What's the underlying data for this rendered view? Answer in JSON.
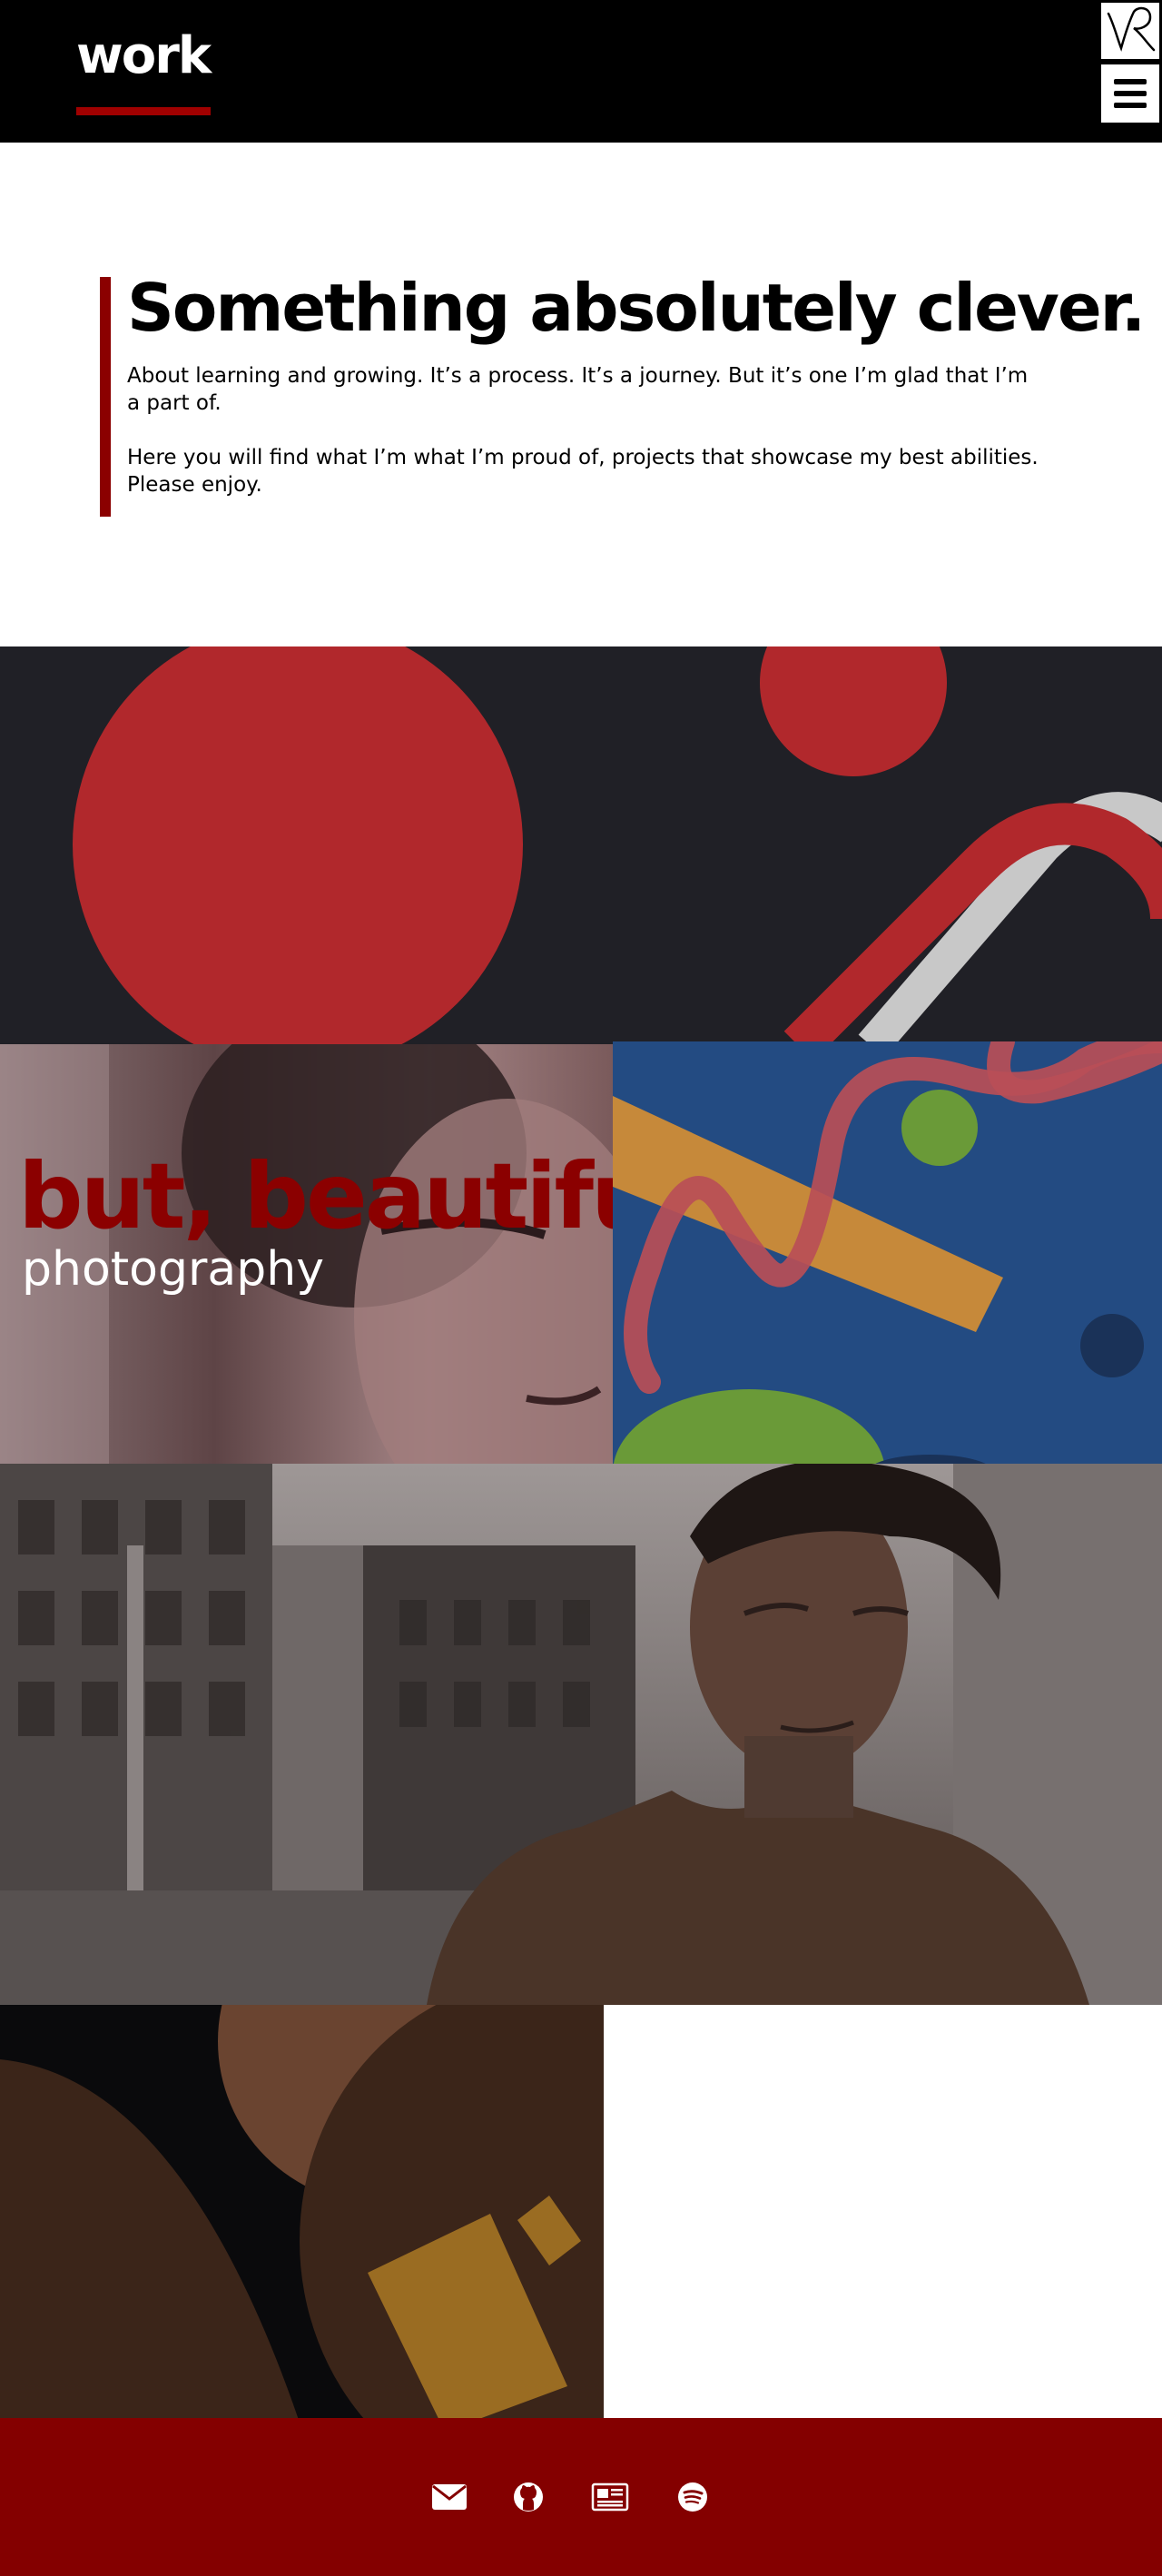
{
  "header": {
    "logo_text": "work",
    "accent_color": "#a00000",
    "monogram_icon": "vr-monogram-icon",
    "menu_icon": "hamburger-menu-icon"
  },
  "intro": {
    "title": "Something absolutely clever.",
    "paragraph_1": "About learning and growing. It’s a  process. It’s a journey.  But it’s one I’m glad that I’m a part of.",
    "paragraph_2": "Here you will find what I’m what I’m proud of, projects that showcase my best abilities. Please enjoy.",
    "bar_color": "#8b0000"
  },
  "projects": {
    "photography_title": "but, beautiful",
    "photography_subtitle": "photography"
  },
  "footer": {
    "background": "#840000",
    "icons": [
      "mail-icon",
      "github-icon",
      "newspaper-icon",
      "spotify-icon"
    ]
  }
}
